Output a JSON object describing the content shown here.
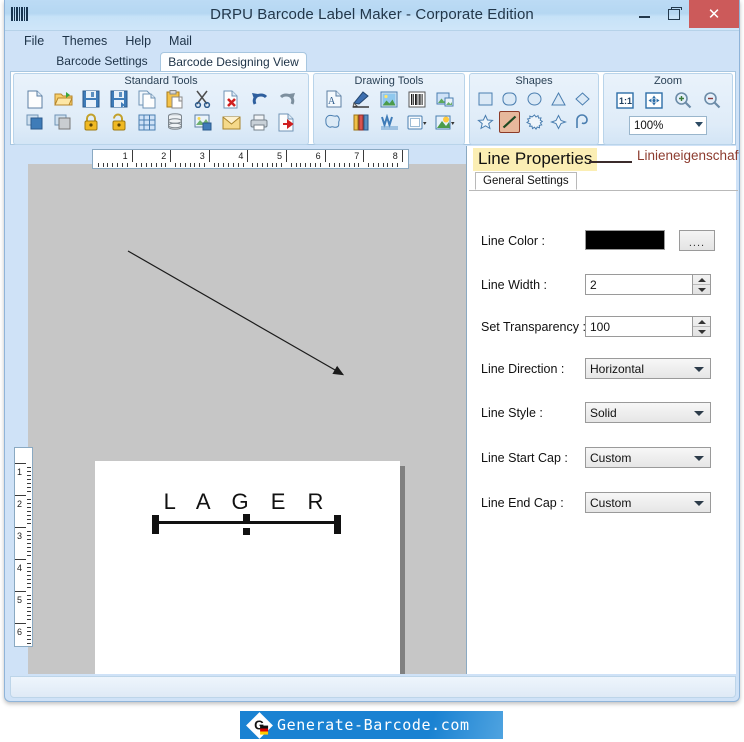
{
  "window": {
    "title": "DRPU Barcode Label Maker - Corporate Edition",
    "app_icon": "barcode-icon",
    "minimize_label": "",
    "restore_label": "",
    "close_label": "✕"
  },
  "menubar": {
    "items": [
      {
        "label": "File",
        "name": "menu-file"
      },
      {
        "label": "Themes",
        "name": "menu-themes"
      },
      {
        "label": "Help",
        "name": "menu-help"
      },
      {
        "label": "Mail",
        "name": "menu-mail"
      }
    ]
  },
  "tabs": [
    {
      "label": "Barcode Settings",
      "active": false
    },
    {
      "label": "Barcode Designing View",
      "active": true
    }
  ],
  "ribbon": {
    "groups": [
      {
        "title": "Standard Tools",
        "row1": [
          "new-document-icon",
          "open-folder-icon",
          "save-icon",
          "save-as-icon",
          "copy-page-icon",
          "paste-clipboard-icon",
          "cut-scissors-icon",
          "delete-page-icon",
          "undo-arrow-icon",
          "redo-arrow-icon"
        ],
        "row2": [
          "copy-objects-icon",
          "duplicate-objects-icon",
          "lock-icon",
          "unlock-icon",
          "grid-icon",
          "database-icon",
          "export-image-icon",
          "email-icon",
          "print-icon",
          "export-file-icon"
        ]
      },
      {
        "title": "Drawing Tools",
        "row1": [
          "text-tool-icon",
          "pencil-tool-icon",
          "picture-tool-icon",
          "barcode-tool-icon",
          "image-frame-icon"
        ],
        "row2": [
          "star-shape-icon",
          "ribbon-tool-icon",
          "watermark-tool-icon",
          "rounded-rect-dropdown-icon",
          "symbol-dropdown-icon"
        ]
      },
      {
        "title": "Shapes",
        "row1": [
          "square-shape-icon",
          "rounded-rect-shape-icon",
          "ellipse-shape-icon",
          "triangle-shape-icon",
          "diamond-shape-icon"
        ],
        "row2": [
          "star-5-shape-icon",
          "line-shape-icon",
          "burst-shape-icon",
          "four-point-star-shape-icon",
          "arc-shape-icon"
        ],
        "selected": "line-shape-icon"
      },
      {
        "title": "Zoom",
        "buttons": [
          "actual-size-icon",
          "fit-page-icon",
          "zoom-in-icon",
          "zoom-out-icon"
        ],
        "level": "100%"
      }
    ]
  },
  "canvas": {
    "h_ruler_ticks": [
      "1",
      "2",
      "3",
      "4",
      "5",
      "6",
      "7",
      "8"
    ],
    "v_ruler_ticks": [
      "1",
      "2",
      "3",
      "4",
      "5",
      "6"
    ],
    "label_text": "L A G E R",
    "selected_object": "line-object"
  },
  "properties": {
    "title": "Line Properties",
    "title_translation": "Linieneigenschaften",
    "subtab": "General Settings",
    "fields": [
      {
        "label": "Line Color :",
        "type": "color",
        "value": "#000000",
        "button": "...."
      },
      {
        "label": "Line Width :",
        "type": "spin",
        "value": "2"
      },
      {
        "label": "Set Transparency :",
        "type": "spin",
        "value": "100"
      },
      {
        "label": "Line Direction :",
        "type": "combo",
        "value": "Horizontal"
      },
      {
        "label": "Line Style :",
        "type": "combo",
        "value": "Solid"
      },
      {
        "label": "Line Start Cap :",
        "type": "combo",
        "value": "Custom"
      },
      {
        "label": "Line End Cap :",
        "type": "combo",
        "value": "Custom"
      }
    ]
  },
  "watermark": {
    "text": "Generate-Barcode.com",
    "logo_letter": "G"
  },
  "colors": {
    "titlebar": "#bcdbf5",
    "close_button": "#cc5a5a",
    "highlight_yellow": "#fbeeb4",
    "translation_red": "#8c3b2e",
    "selected_tool": "#e7b89c",
    "watermark_blue": "#1a82d2"
  }
}
